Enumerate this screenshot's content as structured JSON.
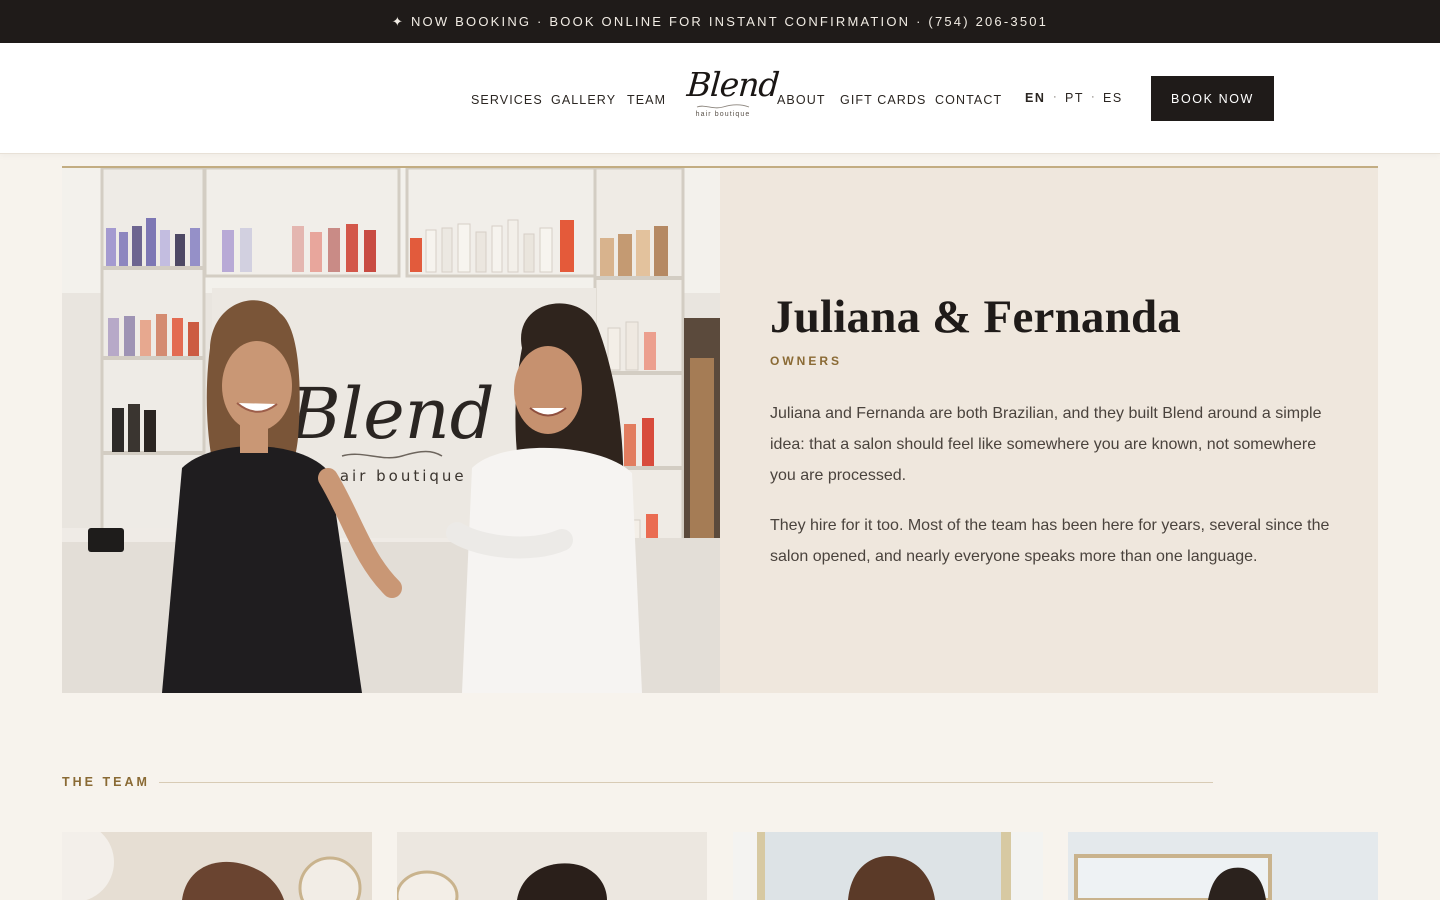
{
  "announcement": {
    "icon": "sparkle-icon",
    "text": "NOW BOOKING · BOOK ONLINE FOR INSTANT CONFIRMATION · (754) 206-3501"
  },
  "header": {
    "nav_left": [
      "SERVICES",
      "GALLERY",
      "TEAM"
    ],
    "nav_right": [
      "ABOUT",
      "GIFT CARDS",
      "CONTACT"
    ],
    "logo": {
      "word": "Blend",
      "tagline": "hair boutique"
    },
    "languages": [
      "EN",
      "PT",
      "ES"
    ],
    "language_separator": "·",
    "book_button": "BOOK NOW"
  },
  "owners": {
    "photo": {
      "sign_word": "Blend",
      "sign_tagline": "hair boutique"
    },
    "name": "Juliana & Fernanda",
    "role": "OWNERS",
    "paragraphs": [
      "Juliana and Fernanda are both Brazilian, and they built Blend around a simple idea: that a salon should feel like somewhere you are known, not somewhere you are processed.",
      "They hire for it too. Most of the team has been here for years, several since the salon opened, and nearly everyone speaks more than one language."
    ]
  },
  "team": {
    "heading": "THE TEAM"
  },
  "colors": {
    "page_bg": "#f7f3ed",
    "dark": "#1f1b19",
    "accent_gold": "#8a6a34",
    "feature_bg": "#efe7dd"
  }
}
